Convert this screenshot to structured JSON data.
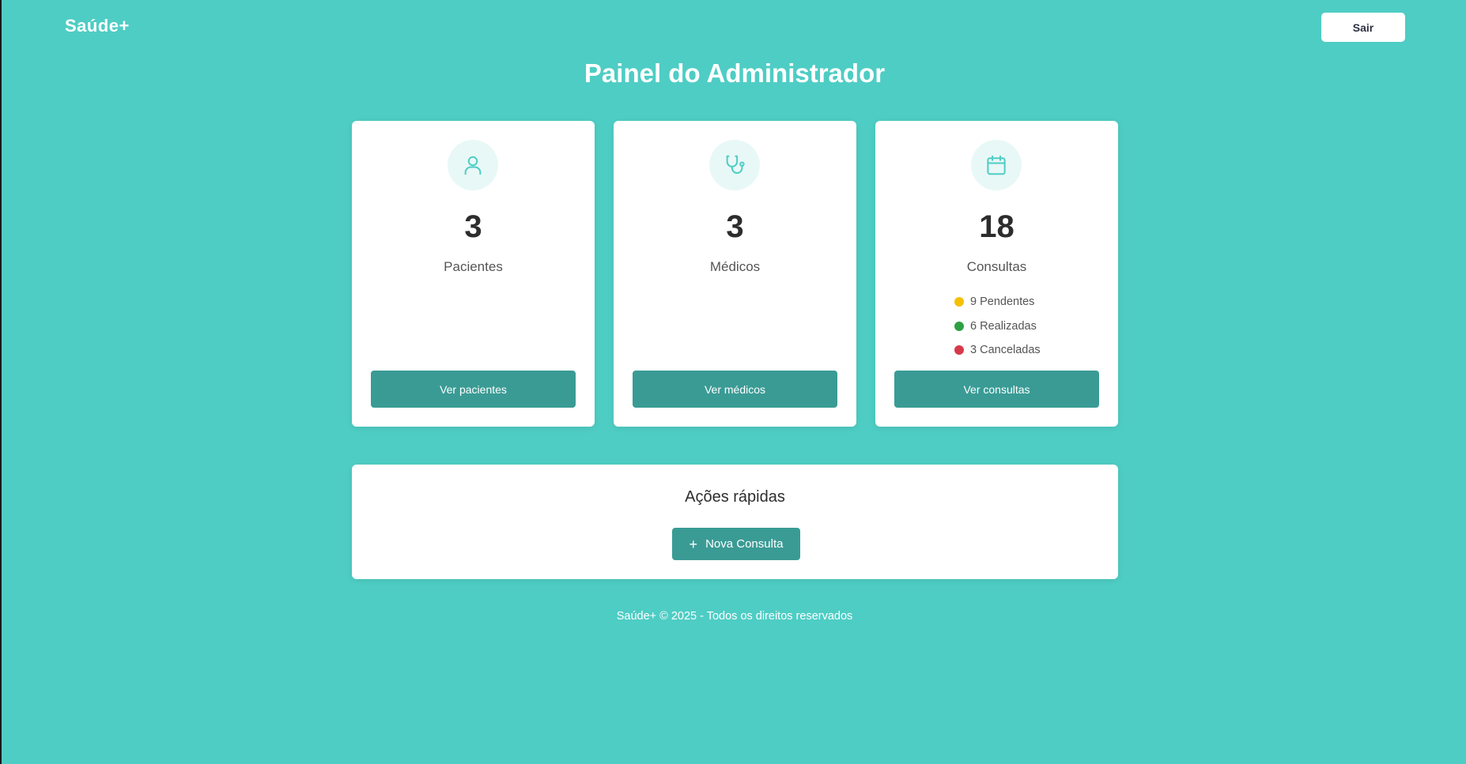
{
  "app": {
    "logo": "Saúde+",
    "logout_label": "Sair"
  },
  "page": {
    "title": "Painel do Administrador"
  },
  "cards": [
    {
      "icon": "user-icon",
      "count": "3",
      "label": "Pacientes",
      "button": "Ver pacientes"
    },
    {
      "icon": "stethoscope-icon",
      "count": "3",
      "label": "Médicos",
      "button": "Ver médicos"
    },
    {
      "icon": "calendar-icon",
      "count": "18",
      "label": "Consultas",
      "button": "Ver consultas",
      "statuses": [
        {
          "text": "9 Pendentes",
          "color": "#f5c000"
        },
        {
          "text": "6 Realizadas",
          "color": "#2ea043"
        },
        {
          "text": "3 Canceladas",
          "color": "#d63a48"
        }
      ]
    }
  ],
  "quick_actions": {
    "title": "Ações rápidas",
    "new_button": "Nova Consulta",
    "new_icon": "plus-icon"
  },
  "footer": {
    "text": "Saúde+ © 2025 - Todos os direitos reservados"
  },
  "colors": {
    "background": "#4ecdc4",
    "primary_button": "#3a9b95",
    "icon_accent": "#4ecdc4"
  }
}
